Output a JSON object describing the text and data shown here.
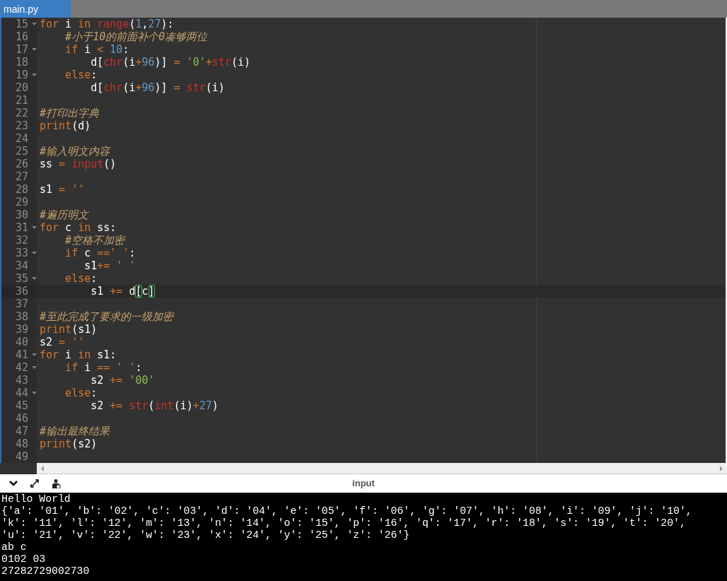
{
  "tabs": [
    {
      "label": "main.py",
      "selected": true
    }
  ],
  "editor": {
    "lines": [
      {
        "number": "15",
        "foldable": true,
        "current": false,
        "tokens": [
          {
            "kind": "kw",
            "text": "for"
          },
          {
            "kind": "plain",
            "text": " i "
          },
          {
            "kind": "kw",
            "text": "in"
          },
          {
            "kind": "builtin",
            "text": " range"
          },
          {
            "kind": "plain",
            "text": "("
          },
          {
            "kind": "num",
            "text": "1"
          },
          {
            "kind": "plain",
            "text": ","
          },
          {
            "kind": "num",
            "text": "27"
          },
          {
            "kind": "plain",
            "text": "):"
          }
        ]
      },
      {
        "number": "16",
        "foldable": false,
        "current": false,
        "tokens": [
          {
            "kind": "comment",
            "text": "    #小于10的前面补个0凑够两位"
          }
        ]
      },
      {
        "number": "17",
        "foldable": true,
        "current": false,
        "tokens": [
          {
            "kind": "kw",
            "text": "    if"
          },
          {
            "kind": "plain",
            "text": " i "
          },
          {
            "kind": "op",
            "text": "<"
          },
          {
            "kind": "num",
            "text": " 10"
          },
          {
            "kind": "plain",
            "text": ":"
          }
        ]
      },
      {
        "number": "18",
        "foldable": false,
        "current": false,
        "tokens": [
          {
            "kind": "plain",
            "text": "        d["
          },
          {
            "kind": "builtin",
            "text": "chr"
          },
          {
            "kind": "plain",
            "text": "(i"
          },
          {
            "kind": "op",
            "text": "+"
          },
          {
            "kind": "num",
            "text": "96"
          },
          {
            "kind": "plain",
            "text": ")] "
          },
          {
            "kind": "op",
            "text": "= "
          },
          {
            "kind": "str",
            "text": "'0'"
          },
          {
            "kind": "op",
            "text": "+"
          },
          {
            "kind": "builtin",
            "text": "str"
          },
          {
            "kind": "plain",
            "text": "(i)"
          }
        ]
      },
      {
        "number": "19",
        "foldable": true,
        "current": false,
        "tokens": [
          {
            "kind": "kw",
            "text": "    else"
          },
          {
            "kind": "plain",
            "text": ":"
          }
        ]
      },
      {
        "number": "20",
        "foldable": false,
        "current": false,
        "tokens": [
          {
            "kind": "plain",
            "text": "        d["
          },
          {
            "kind": "builtin",
            "text": "chr"
          },
          {
            "kind": "plain",
            "text": "(i"
          },
          {
            "kind": "op",
            "text": "+"
          },
          {
            "kind": "num",
            "text": "96"
          },
          {
            "kind": "plain",
            "text": ")] "
          },
          {
            "kind": "op",
            "text": "= "
          },
          {
            "kind": "builtin",
            "text": "str"
          },
          {
            "kind": "plain",
            "text": "(i)"
          }
        ]
      },
      {
        "number": "21",
        "foldable": false,
        "current": false
      },
      {
        "number": "22",
        "foldable": false,
        "current": false,
        "tokens": [
          {
            "kind": "comment",
            "text": "#打印出字典"
          }
        ]
      },
      {
        "number": "23",
        "foldable": false,
        "current": false,
        "tokens": [
          {
            "kind": "kw",
            "text": "print"
          },
          {
            "kind": "plain",
            "text": "(d)"
          }
        ]
      },
      {
        "number": "24",
        "foldable": false,
        "current": false
      },
      {
        "number": "25",
        "foldable": false,
        "current": false,
        "tokens": [
          {
            "kind": "comment",
            "text": "#输入明文内容"
          }
        ]
      },
      {
        "number": "26",
        "foldable": false,
        "current": false,
        "tokens": [
          {
            "kind": "plain",
            "text": "ss "
          },
          {
            "kind": "op",
            "text": "= "
          },
          {
            "kind": "builtin",
            "text": "input"
          },
          {
            "kind": "plain",
            "text": "()"
          }
        ]
      },
      {
        "number": "27",
        "foldable": false,
        "current": false
      },
      {
        "number": "28",
        "foldable": false,
        "current": false,
        "tokens": [
          {
            "kind": "plain",
            "text": "s1 "
          },
          {
            "kind": "op",
            "text": "= ''"
          }
        ]
      },
      {
        "number": "29",
        "foldable": false,
        "current": false
      },
      {
        "number": "30",
        "foldable": false,
        "current": false,
        "tokens": [
          {
            "kind": "comment",
            "text": "#遍历明文"
          }
        ]
      },
      {
        "number": "31",
        "foldable": true,
        "current": false,
        "tokens": [
          {
            "kind": "kw",
            "text": "for"
          },
          {
            "kind": "plain",
            "text": " c "
          },
          {
            "kind": "kw",
            "text": "in"
          },
          {
            "kind": "plain",
            "text": " ss:"
          }
        ]
      },
      {
        "number": "32",
        "foldable": false,
        "current": false,
        "tokens": [
          {
            "kind": "comment",
            "text": "    #空格不加密"
          }
        ]
      },
      {
        "number": "33",
        "foldable": true,
        "current": false,
        "tokens": [
          {
            "kind": "kw",
            "text": "    if"
          },
          {
            "kind": "plain",
            "text": " c "
          },
          {
            "kind": "op",
            "text": "==' '"
          },
          {
            "kind": "plain",
            "text": ":"
          }
        ]
      },
      {
        "number": "34",
        "foldable": false,
        "current": false,
        "tokens": [
          {
            "kind": "plain",
            "text": "       s1"
          },
          {
            "kind": "op",
            "text": "+= ' '"
          }
        ]
      },
      {
        "number": "35",
        "foldable": true,
        "current": false,
        "tokens": [
          {
            "kind": "kw",
            "text": "    else"
          },
          {
            "kind": "plain",
            "text": ":"
          }
        ]
      },
      {
        "number": "36",
        "foldable": false,
        "current": true,
        "tokens": [
          {
            "kind": "plain",
            "text": "        s1 "
          },
          {
            "kind": "op",
            "text": "+="
          },
          {
            "kind": "plain",
            "text": " d"
          },
          {
            "kind": "match",
            "text": "["
          },
          {
            "kind": "plain",
            "text": "c"
          },
          {
            "kind": "match",
            "text": "]"
          }
        ]
      },
      {
        "number": "37",
        "foldable": false,
        "current": false
      },
      {
        "number": "38",
        "foldable": false,
        "current": false,
        "tokens": [
          {
            "kind": "comment",
            "text": "#至此完成了要求的一级加密"
          }
        ]
      },
      {
        "number": "39",
        "foldable": false,
        "current": false,
        "tokens": [
          {
            "kind": "kw",
            "text": "print"
          },
          {
            "kind": "plain",
            "text": "(s1)"
          }
        ]
      },
      {
        "number": "40",
        "foldable": false,
        "current": false,
        "tokens": [
          {
            "kind": "plain",
            "text": "s2 "
          },
          {
            "kind": "op",
            "text": "= ''"
          }
        ]
      },
      {
        "number": "41",
        "foldable": true,
        "current": false,
        "tokens": [
          {
            "kind": "kw",
            "text": "for"
          },
          {
            "kind": "plain",
            "text": " i "
          },
          {
            "kind": "kw",
            "text": "in"
          },
          {
            "kind": "plain",
            "text": " s1:"
          }
        ]
      },
      {
        "number": "42",
        "foldable": true,
        "current": false,
        "tokens": [
          {
            "kind": "kw",
            "text": "    if"
          },
          {
            "kind": "plain",
            "text": " i "
          },
          {
            "kind": "op",
            "text": "== ' '"
          },
          {
            "kind": "plain",
            "text": ":"
          }
        ]
      },
      {
        "number": "43",
        "foldable": false,
        "current": false,
        "tokens": [
          {
            "kind": "plain",
            "text": "        s2 "
          },
          {
            "kind": "op",
            "text": "+= "
          },
          {
            "kind": "str",
            "text": "'00'"
          }
        ]
      },
      {
        "number": "44",
        "foldable": true,
        "current": false,
        "tokens": [
          {
            "kind": "kw",
            "text": "    else"
          },
          {
            "kind": "plain",
            "text": ":"
          }
        ]
      },
      {
        "number": "45",
        "foldable": false,
        "current": false,
        "tokens": [
          {
            "kind": "plain",
            "text": "        s2 "
          },
          {
            "kind": "op",
            "text": "+= "
          },
          {
            "kind": "builtin",
            "text": "str"
          },
          {
            "kind": "plain",
            "text": "("
          },
          {
            "kind": "builtin",
            "text": "int"
          },
          {
            "kind": "plain",
            "text": "(i)"
          },
          {
            "kind": "op",
            "text": "+"
          },
          {
            "kind": "num",
            "text": "27"
          },
          {
            "kind": "plain",
            "text": ")"
          }
        ]
      },
      {
        "number": "46",
        "foldable": false,
        "current": false
      },
      {
        "number": "47",
        "foldable": false,
        "current": false,
        "tokens": [
          {
            "kind": "comment",
            "text": "#输出最终结果"
          }
        ]
      },
      {
        "number": "48",
        "foldable": false,
        "current": false,
        "tokens": [
          {
            "kind": "kw",
            "text": "print"
          },
          {
            "kind": "plain",
            "text": "(s2)"
          }
        ]
      },
      {
        "number": "49",
        "foldable": false,
        "current": false
      }
    ]
  },
  "console": {
    "title": "input",
    "lines": [
      "Hello World",
      "{'a': '01', 'b': '02', 'c': '03', 'd': '04', 'e': '05', 'f': '06', 'g': '07', 'h': '08', 'i': '09', 'j': '10', 'k': '11', 'l': '12', 'm': '13', 'n': '14', 'o': '15', 'p': '16', 'q': '17', 'r': '18', 's': '19', 't': '20', 'u': '21', 'v': '22', 'w': '23', 'x': '24', 'y': '25', 'z': '26'}",
      "ab c",
      "0102 03",
      "27282729002730"
    ]
  }
}
